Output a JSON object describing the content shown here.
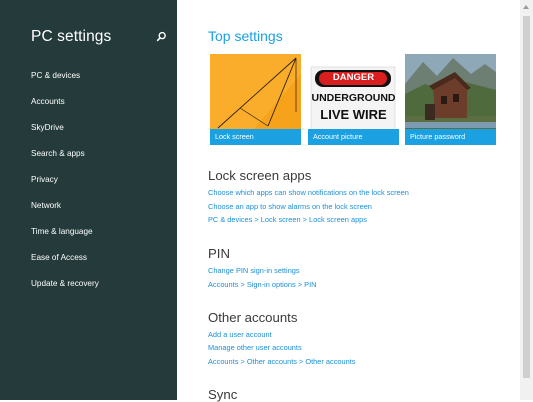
{
  "sidebar": {
    "title": "PC settings",
    "search_icon": "search-icon",
    "items": [
      {
        "label": "PC & devices"
      },
      {
        "label": "Accounts"
      },
      {
        "label": "SkyDrive"
      },
      {
        "label": "Search & apps"
      },
      {
        "label": "Privacy"
      },
      {
        "label": "Network"
      },
      {
        "label": "Time & language"
      },
      {
        "label": "Ease of Access"
      },
      {
        "label": "Update & recovery"
      }
    ]
  },
  "main": {
    "top_settings_title": "Top settings",
    "tiles": [
      {
        "label": "Lock screen"
      },
      {
        "label": "Account picture",
        "sign_text": {
          "line1": "DANGER",
          "line2": "UNDERGROUND",
          "line3": "LIVE WIRE"
        }
      },
      {
        "label": "Picture password"
      }
    ],
    "sections": [
      {
        "title": "Lock screen apps",
        "links": [
          "Choose which apps can show notifications on the lock screen",
          "Choose an app to show alarms on the lock screen",
          "PC & devices > Lock screen > Lock screen apps"
        ]
      },
      {
        "title": "PIN",
        "links": [
          "Change PIN sign-in settings",
          "Accounts > Sign-in options > PIN"
        ]
      },
      {
        "title": "Other accounts",
        "links": [
          "Add a user account",
          "Manage other user accounts",
          "Accounts > Other accounts > Other accounts"
        ]
      },
      {
        "title": "Sync",
        "links": []
      }
    ]
  },
  "colors": {
    "sidebar_bg": "#243a3b",
    "accent": "#1ba1e2",
    "link": "#1b8fd6"
  }
}
